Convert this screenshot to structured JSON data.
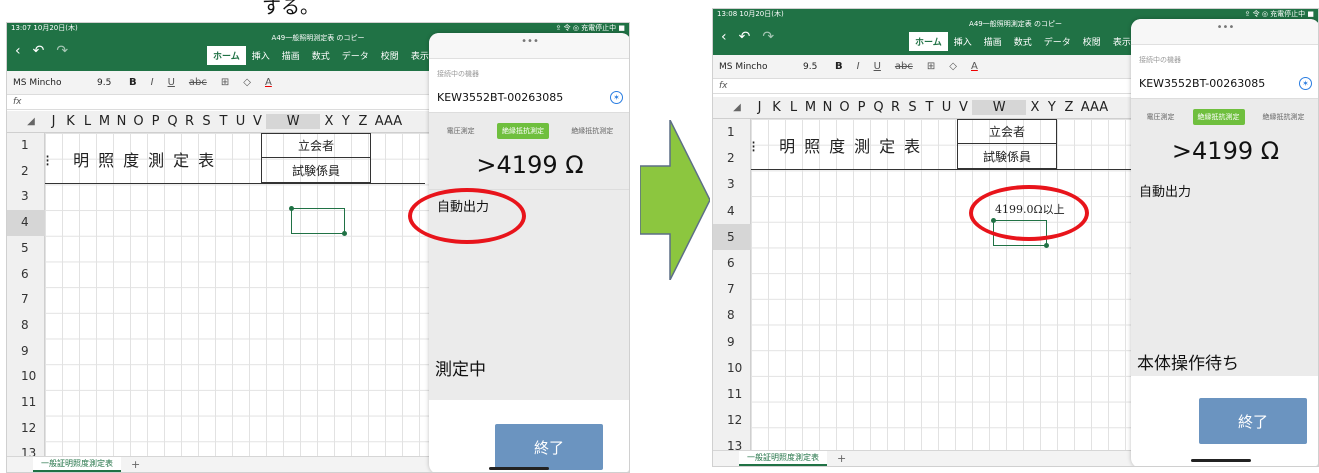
{
  "heading_fragment": "する。",
  "colors": {
    "excel_green": "#207245",
    "accent_green": "#6fbf3e",
    "button_blue": "#6b94c0",
    "annotation_red": "#e8141b",
    "arrow_green": "#8cc63f"
  },
  "left": {
    "status_time": "13:07",
    "status_date": "10月20日(木)",
    "status_right": "⇪ 令 ◎ 充電停止中 ■",
    "window_title": "A49一般照明測定表 のコピー",
    "tabs": [
      "ホーム",
      "挿入",
      "描画",
      "数式",
      "データ",
      "校閲",
      "表示"
    ],
    "font_name": "MS Mincho",
    "font_size": "9.5",
    "fx": "fx",
    "columns": [
      "J",
      "K",
      "L",
      "M",
      "N",
      "O",
      "P",
      "Q",
      "R",
      "S",
      "T",
      "U",
      "V",
      "W",
      "X",
      "Y",
      "Z",
      "AAA"
    ],
    "rows": [
      "1",
      "2",
      "3",
      "4",
      "5",
      "6",
      "7",
      "8",
      "9",
      "10",
      "11",
      "12",
      "13"
    ],
    "sheet_title": "明照度測定表",
    "witness_label": "立会者",
    "tester_label": "試験係員",
    "sheet_tab": "一般証明照度測定表",
    "plus": "+",
    "panel": {
      "dots": "•••",
      "device_label": "接続中の機器",
      "device_id": "KEW3552BT-00263085",
      "modes": [
        "電圧測定",
        "絶縁抵抗測定",
        "絶縁抵抗測定"
      ],
      "reading": ">4199 Ω",
      "auto_output": "自動出力",
      "status": "測定中",
      "end_button": "終了"
    }
  },
  "right": {
    "status_time": "13:08",
    "status_date": "10月20日(木)",
    "status_right": "⇪ 令 ◎ 充電停止中 ■",
    "window_title": "A49一般照明測定表 のコピー",
    "tabs": [
      "ホーム",
      "挿入",
      "描画",
      "数式",
      "データ",
      "校閲",
      "表示"
    ],
    "font_name": "MS Mincho",
    "font_size": "9.5",
    "fx": "fx",
    "columns": [
      "J",
      "K",
      "L",
      "M",
      "N",
      "O",
      "P",
      "Q",
      "R",
      "S",
      "T",
      "U",
      "V",
      "W",
      "X",
      "Y",
      "Z",
      "AAA"
    ],
    "rows": [
      "1",
      "2",
      "3",
      "4",
      "5",
      "6",
      "7",
      "8",
      "9",
      "10",
      "11",
      "12",
      "13"
    ],
    "sheet_title": "明照度測定表",
    "witness_label": "立会者",
    "tester_label": "試験係員",
    "cell_value": "4199.0Ω以上",
    "sheet_tab": "一般証明照度測定表",
    "plus": "+",
    "panel": {
      "dots": "•••",
      "device_label": "接続中の機器",
      "device_id": "KEW3552BT-00263085",
      "modes": [
        "電圧測定",
        "絶縁抵抗測定",
        "絶縁抵抗測定"
      ],
      "reading": ">4199 Ω",
      "auto_output": "自動出力",
      "status": "本体操作待ち",
      "end_button": "終了"
    }
  }
}
